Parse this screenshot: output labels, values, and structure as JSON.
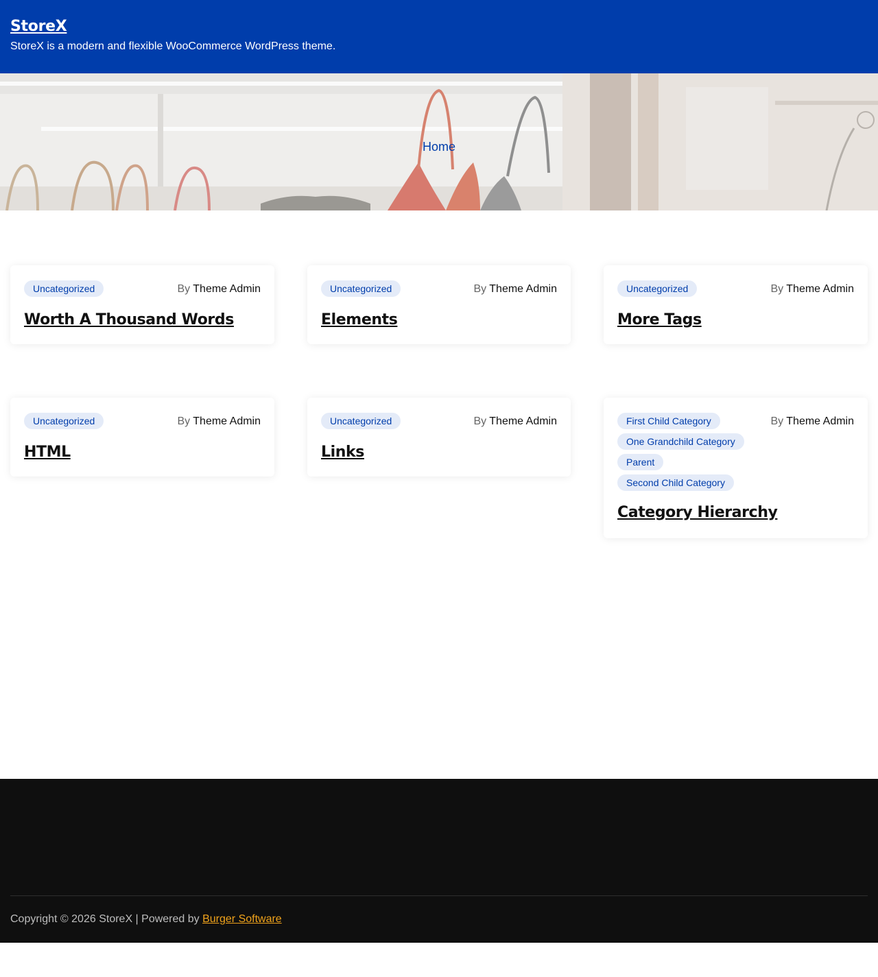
{
  "header": {
    "site_title": "StoreX",
    "tagline": "StoreX is a modern and flexible WooCommerce WordPress theme."
  },
  "hero": {
    "breadcrumb": "Home"
  },
  "posts": [
    {
      "categories": [
        "Uncategorized"
      ],
      "author_prefix": "By",
      "author": "Theme Admin",
      "title": "Worth A Thousand Words"
    },
    {
      "categories": [
        "Uncategorized"
      ],
      "author_prefix": "By",
      "author": "Theme Admin",
      "title": "Elements"
    },
    {
      "categories": [
        "Uncategorized"
      ],
      "author_prefix": "By",
      "author": "Theme Admin",
      "title": "More Tags"
    },
    {
      "categories": [
        "Uncategorized"
      ],
      "author_prefix": "By",
      "author": "Theme Admin",
      "title": "HTML"
    },
    {
      "categories": [
        "Uncategorized"
      ],
      "author_prefix": "By",
      "author": "Theme Admin",
      "title": "Links"
    },
    {
      "categories": [
        "First Child Category",
        "One Grandchild Category",
        "Parent",
        "Second Child Category"
      ],
      "author_prefix": "By",
      "author": "Theme Admin",
      "title": "Category Hierarchy"
    }
  ],
  "footer": {
    "copyright": "Copyright © 2026 StoreX | Powered by ",
    "powered_by_link": "Burger Software"
  },
  "colors": {
    "header_bg": "#003dab",
    "category_pill_bg": "#e4ebf8",
    "footer_bg": "#0f0f0f",
    "footer_link": "#f0a31b"
  }
}
